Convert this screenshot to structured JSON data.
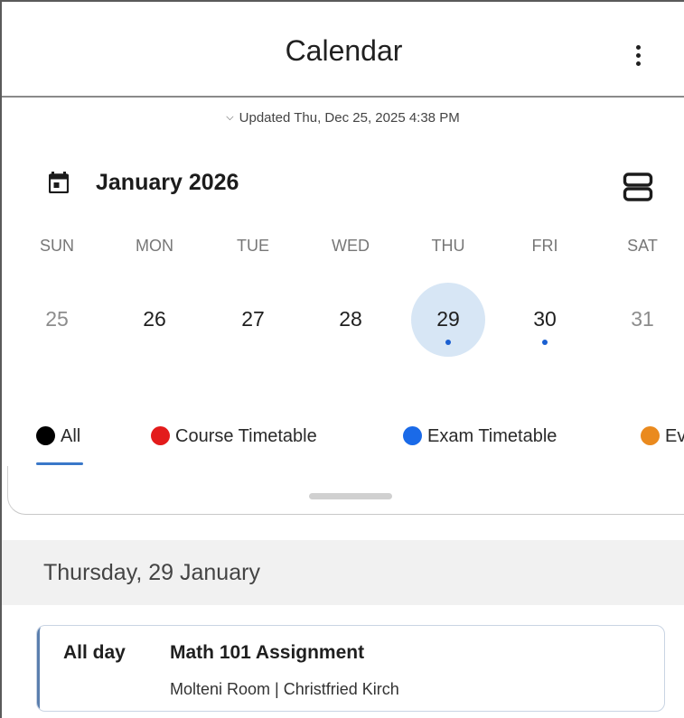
{
  "appbar": {
    "title": "Calendar",
    "menu_icon": "more-vert-icon"
  },
  "sync": {
    "chevron_icon": "chevron-down-icon",
    "updated_text": "Updated Thu, Dec 25, 2025 4:38 PM"
  },
  "month": {
    "icon": "calendar-icon",
    "title": "January 2026",
    "view_toggle_icon": "view-agenda-icon"
  },
  "weekdays": [
    "SUN",
    "MON",
    "TUE",
    "WED",
    "THU",
    "FRI",
    "SAT"
  ],
  "days": [
    {
      "label": "25",
      "muted": true,
      "selected": false,
      "has_event": false
    },
    {
      "label": "26",
      "muted": false,
      "selected": false,
      "has_event": false
    },
    {
      "label": "27",
      "muted": false,
      "selected": false,
      "has_event": false
    },
    {
      "label": "28",
      "muted": false,
      "selected": false,
      "has_event": false
    },
    {
      "label": "29",
      "muted": false,
      "selected": true,
      "has_event": true
    },
    {
      "label": "30",
      "muted": false,
      "selected": false,
      "has_event": true
    },
    {
      "label": "31",
      "muted": true,
      "selected": false,
      "has_event": false
    }
  ],
  "filters": [
    {
      "label": "All",
      "color": "#000000",
      "active": true
    },
    {
      "label": "Course Timetable",
      "color": "#e31b1b",
      "active": false
    },
    {
      "label": "Exam Timetable",
      "color": "#1a6ae8",
      "active": false
    },
    {
      "label": "Ev",
      "color": "#ea8a1e",
      "active": false
    }
  ],
  "agenda": {
    "date_header": "Thursday, 29 January",
    "events": [
      {
        "time": "All day",
        "title": "Math 101 Assignment",
        "subtitle": "Molteni Room | Christfried Kirch"
      }
    ]
  },
  "colors": {
    "selected_day_bg": "#d7e6f5",
    "event_dot": "#1a5fd1",
    "tab_underline": "#3a78c9"
  }
}
